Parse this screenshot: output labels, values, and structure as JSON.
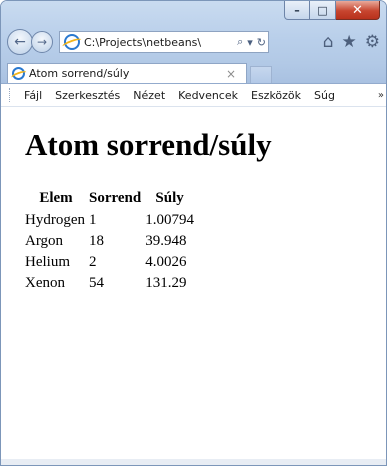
{
  "window": {
    "caption": {
      "minimize": "–",
      "maximize": "□",
      "close": "✕"
    }
  },
  "navigation": {
    "back_glyph": "←",
    "forward_glyph": "→",
    "address": "C:\\Projects\\netbeans\\",
    "search_glyph": "⌕",
    "dropdown_glyph": "▾",
    "refresh_glyph": "↻",
    "home_glyph": "⌂",
    "favorites_glyph": "★",
    "settings_glyph": "⚙"
  },
  "tab": {
    "title": "Atom sorrend/súly",
    "close_glyph": "×"
  },
  "menu": {
    "items": [
      "Fájl",
      "Szerkesztés",
      "Nézet",
      "Kedvencek",
      "Eszközök",
      "Súg"
    ],
    "overflow": "»"
  },
  "page": {
    "heading": "Atom sorrend/súly",
    "table": {
      "headers": [
        "Elem",
        "Sorrend",
        "Súly"
      ],
      "rows": [
        [
          "Hydrogen",
          "1",
          "1.00794"
        ],
        [
          "Argon",
          "18",
          "39.948"
        ],
        [
          "Helium",
          "2",
          "4.0026"
        ],
        [
          "Xenon",
          "54",
          "131.29"
        ]
      ]
    }
  },
  "colors": {
    "chrome": "#b9cfea",
    "close_button": "#c7452f",
    "ie_blue": "#2a79d0"
  }
}
